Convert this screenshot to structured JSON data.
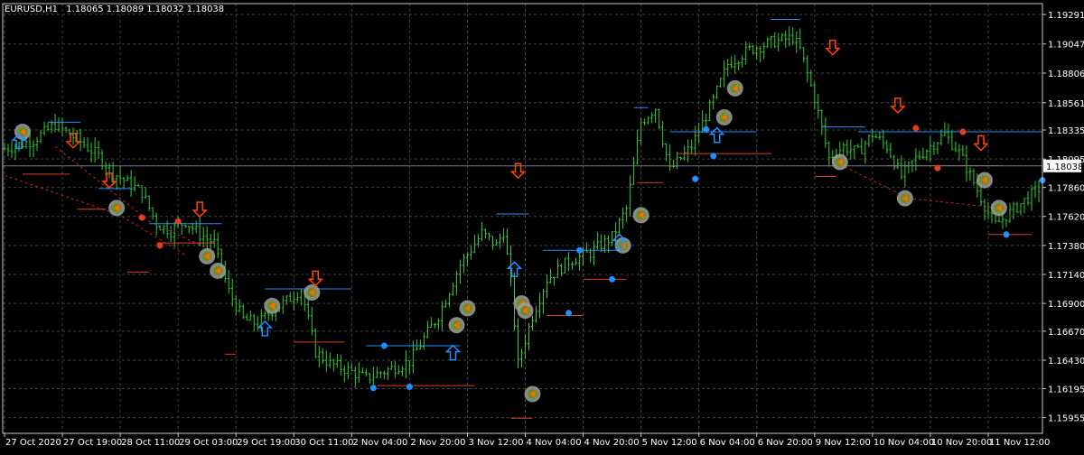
{
  "header": {
    "symbol": "EURUSD,H1",
    "ohlc": "1.18065 1.18089 1.18032 1.18038"
  },
  "colors": {
    "background": "#000000",
    "grid": "#3a4a3a",
    "frame": "#c8c8c8",
    "text": "#ffffff",
    "bars": "#33cc33",
    "current_price_line": "#708090",
    "level_blue": "#1e90ff",
    "level_red": "#e53b1f",
    "arrow_up": "#1e90ff",
    "arrow_down": "#ff4500",
    "signal_circle": "#a0a0a0",
    "dashed_trend": "#cc2222"
  },
  "chart_data": {
    "type": "candlestick",
    "symbol": "EURUSD",
    "timeframe": "H1",
    "last_ohlc": {
      "open": 1.18065,
      "high": 1.18089,
      "low": 1.18032,
      "close": 1.18038
    },
    "current_price": 1.18038,
    "current_price_label": "1.18038",
    "ylim": [
      1.15825,
      1.19381
    ],
    "y_ticks": [
      {
        "value": 1.19291,
        "label": "1.19291"
      },
      {
        "value": 1.19047,
        "label": "1.19047"
      },
      {
        "value": 1.18806,
        "label": "1.18806"
      },
      {
        "value": 1.18561,
        "label": "1.18561"
      },
      {
        "value": 1.18335,
        "label": "1.18335"
      },
      {
        "value": 1.18095,
        "label": "1.18095"
      },
      {
        "value": 1.1786,
        "label": "1.17860"
      },
      {
        "value": 1.1762,
        "label": "1.17620"
      },
      {
        "value": 1.1738,
        "label": "1.17380"
      },
      {
        "value": 1.1714,
        "label": "1.17140"
      },
      {
        "value": 1.169,
        "label": "1.16900"
      },
      {
        "value": 1.1667,
        "label": "1.16670"
      },
      {
        "value": 1.1643,
        "label": "1.16430"
      },
      {
        "value": 1.16195,
        "label": "1.16195"
      },
      {
        "value": 1.15955,
        "label": "1.15955"
      }
    ],
    "x_labels": [
      "27 Oct 2020",
      "27 Oct 19:00",
      "28 Oct 11:00",
      "29 Oct 03:00",
      "29 Oct 19:00",
      "30 Oct 11:00",
      "2 Nov 04:00",
      "2 Nov 20:00",
      "3 Nov 12:00",
      "4 Nov 04:00",
      "4 Nov 20:00",
      "5 Nov 12:00",
      "6 Nov 04:00",
      "6 Nov 20:00",
      "9 Nov 12:00",
      "10 Nov 04:00",
      "10 Nov 20:00",
      "11 Nov 12:00"
    ],
    "x_label_bar_index": [
      0,
      16,
      32,
      48,
      64,
      80,
      96,
      112,
      128,
      144,
      160,
      176,
      192,
      208,
      224,
      240,
      256,
      272
    ],
    "bar_count": 287,
    "grid": true,
    "close_path": [
      [
        0,
        1.1818
      ],
      [
        8,
        1.1825
      ],
      [
        14,
        1.1838
      ],
      [
        20,
        1.1826
      ],
      [
        26,
        1.1812
      ],
      [
        30,
        1.1798
      ],
      [
        34,
        1.179
      ],
      [
        38,
        1.1782
      ],
      [
        42,
        1.1756
      ],
      [
        46,
        1.175
      ],
      [
        50,
        1.1758
      ],
      [
        54,
        1.1747
      ],
      [
        58,
        1.174
      ],
      [
        62,
        1.17
      ],
      [
        66,
        1.1677
      ],
      [
        70,
        1.1673
      ],
      [
        74,
        1.1684
      ],
      [
        78,
        1.1692
      ],
      [
        82,
        1.1702
      ],
      [
        86,
        1.165
      ],
      [
        90,
        1.164
      ],
      [
        94,
        1.1636
      ],
      [
        100,
        1.1628
      ],
      [
        106,
        1.1635
      ],
      [
        112,
        1.1642
      ],
      [
        120,
        1.168
      ],
      [
        126,
        1.1722
      ],
      [
        132,
        1.1748
      ],
      [
        136,
        1.1738
      ],
      [
        138,
        1.175
      ],
      [
        140,
        1.1708
      ],
      [
        142,
        1.164
      ],
      [
        146,
        1.168
      ],
      [
        150,
        1.171
      ],
      [
        156,
        1.1725
      ],
      [
        162,
        1.1732
      ],
      [
        168,
        1.1745
      ],
      [
        172,
        1.1768
      ],
      [
        176,
        1.184
      ],
      [
        180,
        1.1852
      ],
      [
        184,
        1.18
      ],
      [
        190,
        1.182
      ],
      [
        196,
        1.1858
      ],
      [
        200,
        1.1888
      ],
      [
        206,
        1.19
      ],
      [
        212,
        1.1906
      ],
      [
        218,
        1.191
      ],
      [
        220,
        1.19
      ],
      [
        224,
        1.186
      ],
      [
        228,
        1.181
      ],
      [
        232,
        1.182
      ],
      [
        236,
        1.1815
      ],
      [
        240,
        1.183
      ],
      [
        244,
        1.182
      ],
      [
        248,
        1.1795
      ],
      [
        252,
        1.181
      ],
      [
        256,
        1.182
      ],
      [
        260,
        1.183
      ],
      [
        264,
        1.1815
      ],
      [
        268,
        1.179
      ],
      [
        272,
        1.1765
      ],
      [
        274,
        1.1755
      ],
      [
        278,
        1.1765
      ],
      [
        282,
        1.1775
      ],
      [
        286,
        1.1785
      ]
    ],
    "levels": [
      {
        "color": "blue",
        "from": 12,
        "to": 21,
        "price": 1.184
      },
      {
        "color": "red",
        "from": 5,
        "to": 18,
        "price": 1.1797
      },
      {
        "color": "blue",
        "from": 26,
        "to": 35,
        "price": 1.1785
      },
      {
        "color": "red",
        "from": 20,
        "to": 28,
        "price": 1.1768
      },
      {
        "color": "blue",
        "from": 40,
        "to": 60,
        "price": 1.1756
      },
      {
        "color": "red",
        "from": 42,
        "to": 58,
        "price": 1.174
      },
      {
        "color": "red",
        "from": 34,
        "to": 40,
        "price": 1.1716
      },
      {
        "color": "blue",
        "from": 72,
        "to": 96,
        "price": 1.1702
      },
      {
        "color": "red",
        "from": 80,
        "to": 94,
        "price": 1.1658
      },
      {
        "color": "red",
        "from": 61,
        "to": 64,
        "price": 1.1648
      },
      {
        "color": "blue",
        "from": 100,
        "to": 126,
        "price": 1.1655
      },
      {
        "color": "red",
        "from": 103,
        "to": 130,
        "price": 1.1622
      },
      {
        "color": "blue",
        "from": 136,
        "to": 145,
        "price": 1.1764
      },
      {
        "color": "blue",
        "from": 149,
        "to": 170,
        "price": 1.1734
      },
      {
        "color": "red",
        "from": 150,
        "to": 160,
        "price": 1.168
      },
      {
        "color": "red",
        "from": 160,
        "to": 172,
        "price": 1.171
      },
      {
        "color": "red",
        "from": 140,
        "to": 146,
        "price": 1.1595
      },
      {
        "color": "blue",
        "from": 174,
        "to": 178,
        "price": 1.1852
      },
      {
        "color": "blue",
        "from": 184,
        "to": 208,
        "price": 1.1832
      },
      {
        "color": "red",
        "from": 186,
        "to": 212,
        "price": 1.1814
      },
      {
        "color": "red",
        "from": 175,
        "to": 182,
        "price": 1.179
      },
      {
        "color": "blue",
        "from": 212,
        "to": 220,
        "price": 1.1925
      },
      {
        "color": "blue",
        "from": 226,
        "to": 238,
        "price": 1.1836
      },
      {
        "color": "red",
        "from": 224,
        "to": 230,
        "price": 1.1795
      },
      {
        "color": "blue",
        "from": 236,
        "to": 287,
        "price": 1.1832
      },
      {
        "color": "red",
        "from": 244,
        "to": 276,
        "price": 1.1804
      },
      {
        "color": "red",
        "from": 272,
        "to": 284,
        "price": 1.1747
      }
    ],
    "dots": [
      {
        "color": "red",
        "bar": 38,
        "price": 1.1761
      },
      {
        "color": "red",
        "bar": 48,
        "price": 1.1758
      },
      {
        "color": "red",
        "bar": 43,
        "price": 1.1738
      },
      {
        "color": "blue",
        "bar": 102,
        "price": 1.162
      },
      {
        "color": "blue",
        "bar": 105,
        "price": 1.1655
      },
      {
        "color": "blue",
        "bar": 112,
        "price": 1.1621
      },
      {
        "color": "blue",
        "bar": 156,
        "price": 1.1682
      },
      {
        "color": "blue",
        "bar": 159,
        "price": 1.1734
      },
      {
        "color": "blue",
        "bar": 168,
        "price": 1.171
      },
      {
        "color": "blue",
        "bar": 191,
        "price": 1.1793
      },
      {
        "color": "blue",
        "bar": 196,
        "price": 1.1812
      },
      {
        "color": "blue",
        "bar": 194,
        "price": 1.1834
      },
      {
        "color": "red",
        "bar": 252,
        "price": 1.1835
      },
      {
        "color": "red",
        "bar": 258,
        "price": 1.1802
      },
      {
        "color": "red",
        "bar": 265,
        "price": 1.1832
      },
      {
        "color": "blue",
        "bar": 277,
        "price": 1.1747
      },
      {
        "color": "blue",
        "bar": 287,
        "price": 1.1792
      }
    ],
    "arrows": [
      {
        "dir": "up",
        "bar": 4,
        "price": 1.1825
      },
      {
        "dir": "down",
        "bar": 19,
        "price": 1.1824
      },
      {
        "dir": "down",
        "bar": 29,
        "price": 1.1791
      },
      {
        "dir": "down",
        "bar": 54,
        "price": 1.1767
      },
      {
        "dir": "up",
        "bar": 72,
        "price": 1.167
      },
      {
        "dir": "down",
        "bar": 86,
        "price": 1.171
      },
      {
        "dir": "up",
        "bar": 124,
        "price": 1.165
      },
      {
        "dir": "down",
        "bar": 142,
        "price": 1.1799
      },
      {
        "dir": "up",
        "bar": 141,
        "price": 1.1719
      },
      {
        "dir": "up",
        "bar": 170,
        "price": 1.1742
      },
      {
        "dir": "up",
        "bar": 197,
        "price": 1.183
      },
      {
        "dir": "down",
        "bar": 229,
        "price": 1.1901
      },
      {
        "dir": "down",
        "bar": 247,
        "price": 1.1853
      },
      {
        "dir": "down",
        "bar": 270,
        "price": 1.1822
      }
    ],
    "signals": [
      {
        "bar": 5,
        "price": 1.1832
      },
      {
        "bar": 31,
        "price": 1.1769
      },
      {
        "bar": 56,
        "price": 1.1729
      },
      {
        "bar": 59,
        "price": 1.1717
      },
      {
        "bar": 74,
        "price": 1.1688
      },
      {
        "bar": 85,
        "price": 1.1699
      },
      {
        "bar": 125,
        "price": 1.1672
      },
      {
        "bar": 128,
        "price": 1.1686
      },
      {
        "bar": 143,
        "price": 1.169
      },
      {
        "bar": 144,
        "price": 1.1684
      },
      {
        "bar": 146,
        "price": 1.1615
      },
      {
        "bar": 171,
        "price": 1.1738
      },
      {
        "bar": 176,
        "price": 1.1763
      },
      {
        "bar": 199,
        "price": 1.1844
      },
      {
        "bar": 202,
        "price": 1.1868
      },
      {
        "bar": 231,
        "price": 1.1807
      },
      {
        "bar": 249,
        "price": 1.1777
      },
      {
        "bar": 271,
        "price": 1.1792
      },
      {
        "bar": 275,
        "price": 1.1769
      }
    ],
    "dashed_lines": [
      {
        "points": [
          [
            0,
            1.1796
          ],
          [
            32,
            1.1763
          ],
          [
            50,
            1.173
          ]
        ]
      },
      {
        "points": [
          [
            14,
            1.182
          ],
          [
            40,
            1.1758
          ],
          [
            60,
            1.173
          ]
        ]
      },
      {
        "points": [
          [
            231,
            1.1805
          ],
          [
            250,
            1.1777
          ],
          [
            275,
            1.1769
          ]
        ]
      }
    ]
  }
}
